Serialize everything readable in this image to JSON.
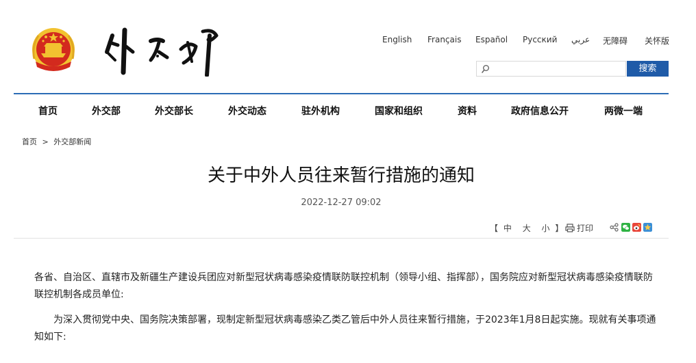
{
  "header": {
    "logo_alt": "外交部",
    "languages": [
      "English",
      "Français",
      "Español",
      "Русский",
      "عربي",
      "无障碍",
      "关怀版"
    ]
  },
  "search": {
    "value": "",
    "placeholder": "",
    "button_label": "搜索"
  },
  "nav": {
    "items": [
      "首页",
      "外交部",
      "外交部长",
      "外交动态",
      "驻外机构",
      "国家和组织",
      "资料",
      "政府信息公开",
      "两微一端"
    ]
  },
  "breadcrumb": {
    "home": "首页",
    "separator": ">",
    "current": "外交部新闻"
  },
  "article": {
    "title": "关于中外人员往来暂行措施的通知",
    "date": "2022-12-27 09:02",
    "font_size": {
      "open": "【",
      "large": "中",
      "medium": "大",
      "small": "小",
      "close": "】"
    },
    "print_label": "打印",
    "paragraphs": [
      "各省、自治区、直辖市及新疆生产建设兵团应对新型冠状病毒感染疫情联防联控机制（领导小组、指挥部），国务院应对新型冠状病毒感染疫情联防联控机制各成员单位:",
      "为深入贯彻党中央、国务院决策部署，现制定新型冠状病毒感染乙类乙管后中外人员往来暂行措施，于2023年1月8日起实施。现就有关事项通知如下:"
    ]
  },
  "colors": {
    "brand_blue": "#1f5ba8",
    "nav_rule": "#2b6cb5",
    "emblem_red": "#d32a1e",
    "emblem_gold": "#f2c230"
  },
  "icons": [
    "national-emblem-icon",
    "search-icon",
    "printer-icon",
    "share-icon",
    "wechat-icon",
    "weibo-icon",
    "qzone-icon"
  ]
}
